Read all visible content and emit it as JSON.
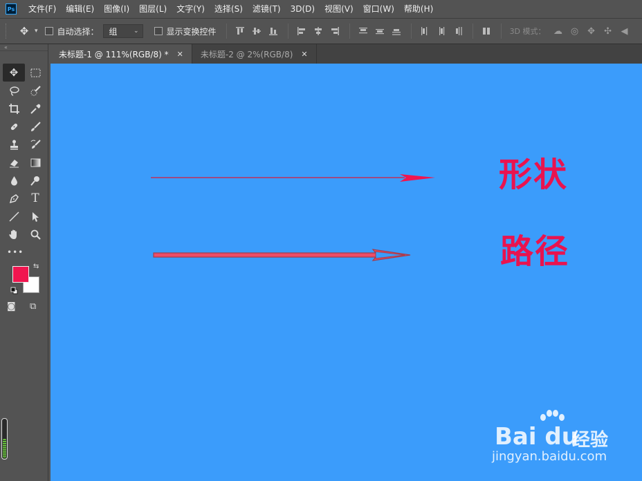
{
  "app": {
    "logo_text": "Ps"
  },
  "menu": {
    "items": [
      "文件(F)",
      "编辑(E)",
      "图像(I)",
      "图层(L)",
      "文字(Y)",
      "选择(S)",
      "滤镜(T)",
      "3D(D)",
      "视图(V)",
      "窗口(W)",
      "帮助(H)"
    ]
  },
  "options": {
    "auto_select_label": "自动选择：",
    "auto_select_checked": false,
    "auto_select_value": "组",
    "show_transform_label": "显示变换控件",
    "show_transform_checked": false,
    "mode_3d_label": "3D 模式："
  },
  "tabs": [
    {
      "label": "未标题-1 @ 111%(RGB/8) *",
      "active": true
    },
    {
      "label": "未标题-2 @ 2%(RGB/8)",
      "active": false
    }
  ],
  "colors": {
    "foreground": "#f0154f",
    "background": "#ffffff",
    "canvas": "#3b9cfb",
    "accent_text": "#e9134f"
  },
  "canvas": {
    "label_shape": "形状",
    "label_path": "路径"
  },
  "watermark": {
    "logo": "Bai  du",
    "product": "经验",
    "url": "jingyan.baidu.com"
  }
}
